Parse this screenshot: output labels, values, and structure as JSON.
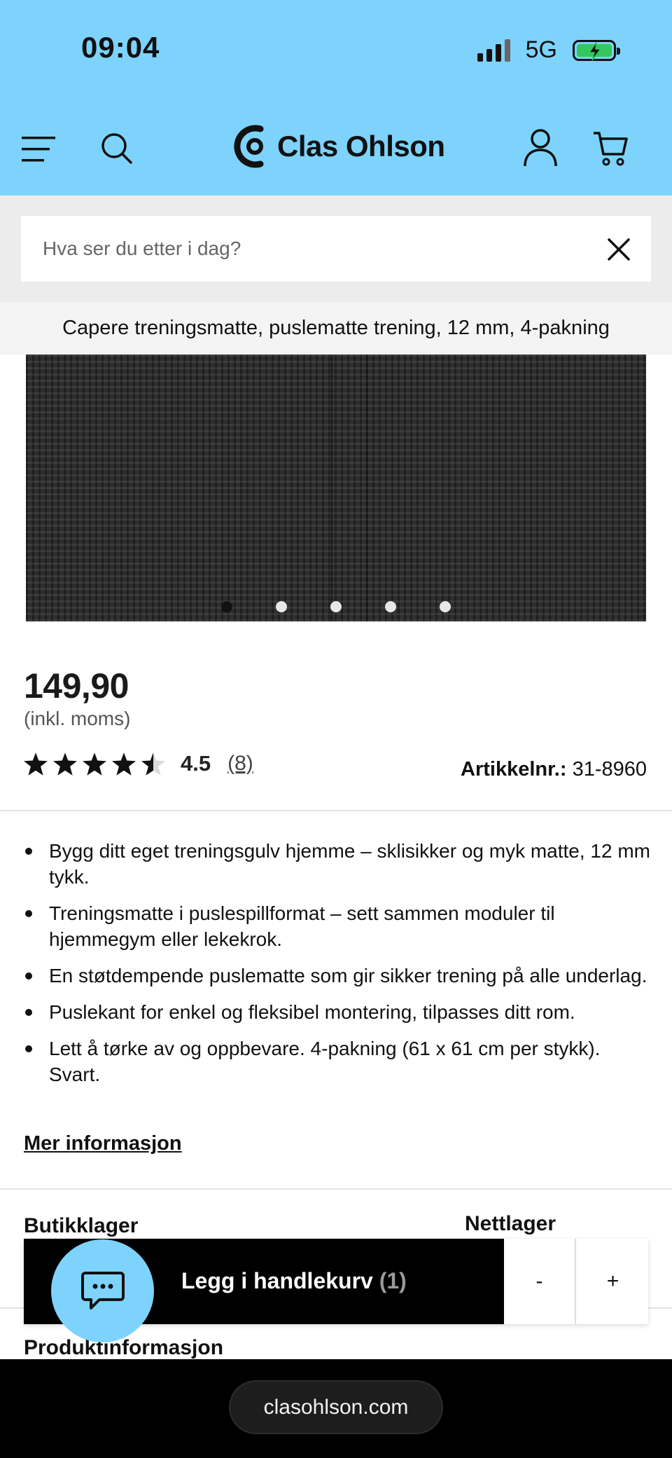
{
  "status_bar": {
    "time": "09:04",
    "network": "5G"
  },
  "header": {
    "logo_text": "Clas Ohlson",
    "icons": [
      "menu-icon",
      "search-icon",
      "account-icon",
      "cart-icon"
    ],
    "background": "#7dd3fb"
  },
  "search": {
    "placeholder": "Hva ser du etter i dag?",
    "value": ""
  },
  "product": {
    "title": "Capere treningsmatte, puslematte trening, 12 mm, 4-pakning",
    "gallery": {
      "image_count": 5,
      "active_index": 0
    },
    "price": "149,90",
    "vat_note": "(inkl. moms)",
    "rating": {
      "value": "4.5",
      "count": "(8)",
      "stars": 4.5,
      "max": 5
    },
    "article_label": "Artikkelnr.:",
    "article_number": "31-8960",
    "bullets": [
      "Bygg ditt eget treningsgulv hjemme – sklisikker og myk matte, 12 mm tykk.",
      "Treningsmatte i puslespillformat – sett sammen moduler til hjemmegym eller lekekrok.",
      "En støtdempende puslematte som gir sikker trening på alle underlag.",
      "Puslekant for enkel og fleksibel montering, tilpasses ditt rom.",
      "Lett å tørke av og oppbevare. 4-pakning (61 x 61 cm per stykk). Svart."
    ],
    "more_info_link": "Mer informasjon"
  },
  "stock": {
    "store_label": "Butikklager",
    "online_label": "Nettlager"
  },
  "product_info_label": "Produktinformasjon",
  "cart_bar": {
    "add_label": "Legg i handlekurv",
    "quantity": "(1)",
    "minus": "-",
    "plus": "+"
  },
  "chat_button": {
    "icon": "chat-icon"
  },
  "browser": {
    "url": "clasohlson.com"
  }
}
